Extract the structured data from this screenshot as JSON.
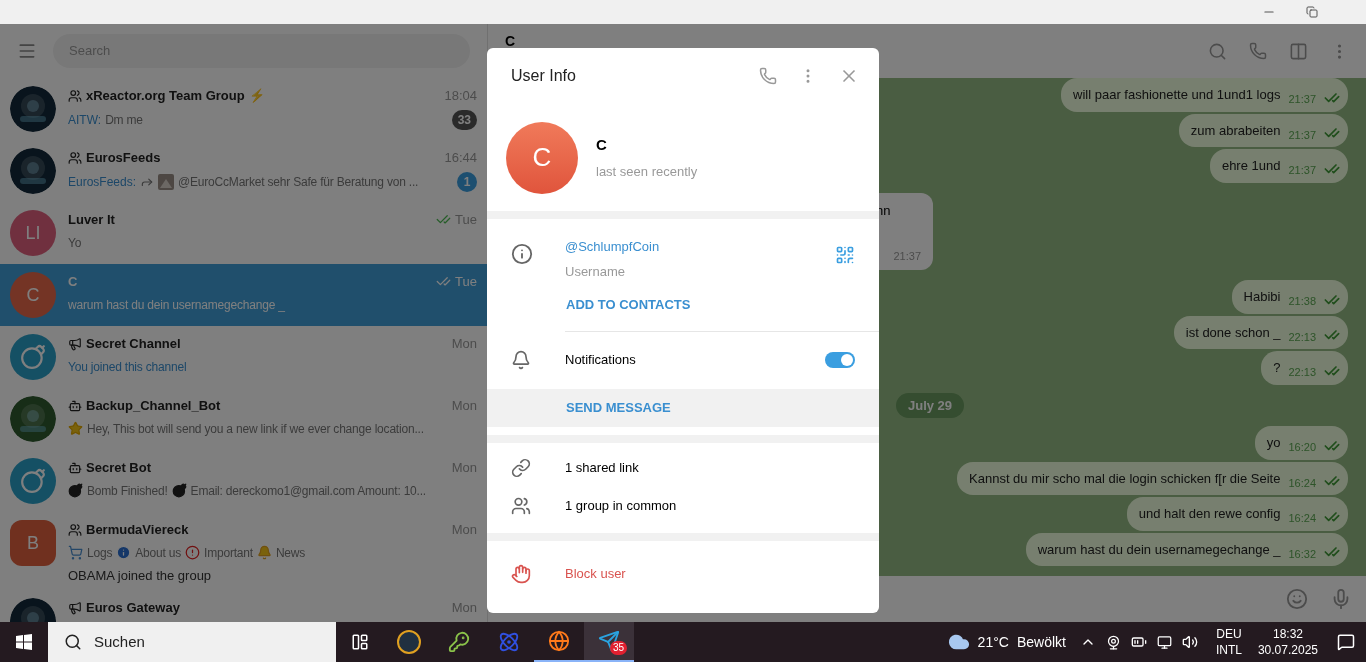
{
  "sidebar": {
    "search_placeholder": "Search",
    "chats": [
      {
        "kind": "group",
        "name": "xReactor.org Team Group",
        "name_suffix": "⚡",
        "time": "18:04",
        "avatar": {
          "kind": "picture"
        },
        "sender": "AITW:",
        "preview": [
          {
            "kind": "text",
            "text": "Dm me"
          }
        ],
        "badge": {
          "text": "33",
          "muted": true
        },
        "selected": false
      },
      {
        "kind": "group",
        "name": "EurosFeeds",
        "time": "16:44",
        "avatar": {
          "kind": "picture"
        },
        "sender": "EurosFeeds:",
        "preview": [
          {
            "kind": "forward"
          },
          {
            "kind": "thumb"
          },
          {
            "kind": "text",
            "text": "@EuroCcMarket sehr Safe für Beratung von ..."
          }
        ],
        "badge": {
          "text": "1",
          "muted": false
        },
        "selected": false
      },
      {
        "kind": "user",
        "name": "Luver It",
        "time": "Tue",
        "avatar": {
          "kind": "initials",
          "initials": "LI"
        },
        "preview": [
          {
            "kind": "text",
            "text": "Yo"
          }
        ],
        "read": true,
        "selected": false
      },
      {
        "kind": "user",
        "name": "C",
        "time": "Tue",
        "avatar": {
          "kind": "initials",
          "initials": "C"
        },
        "preview": [
          {
            "kind": "text",
            "text": "warum hast du dein usernamegechange _"
          }
        ],
        "read": true,
        "selected": true
      },
      {
        "kind": "channel",
        "name": "Secret Channel",
        "time": "Mon",
        "avatar": {
          "kind": "bomb"
        },
        "service": true,
        "preview": [
          {
            "kind": "text",
            "text": "You joined this channel"
          }
        ],
        "selected": false
      },
      {
        "kind": "bot",
        "name": "Backup_Channel_Bot",
        "time": "Mon",
        "avatar": {
          "kind": "picture"
        },
        "preview": [
          {
            "kind": "star"
          },
          {
            "kind": "text",
            "text": "Hey, This bot will send you a new link if we ever change location..."
          }
        ],
        "selected": false
      },
      {
        "kind": "bot",
        "name": "Secret Bot",
        "time": "Mon",
        "avatar": {
          "kind": "bomb"
        },
        "preview": [
          {
            "kind": "bomb"
          },
          {
            "kind": "text",
            "text": "Bomb Finished!"
          },
          {
            "kind": "bomb"
          },
          {
            "kind": "text",
            "text": "Email: dereckomo1@gmail.com Amount: 10..."
          }
        ],
        "selected": false
      },
      {
        "kind": "group",
        "name": "BermudaViereck",
        "time": "Mon",
        "avatar": {
          "kind": "initials_square",
          "initials": "B"
        },
        "preview": [
          {
            "kind": "cart"
          },
          {
            "kind": "text",
            "text": "Logs"
          },
          {
            "kind": "info"
          },
          {
            "kind": "text",
            "text": "About us"
          },
          {
            "kind": "exclaim"
          },
          {
            "kind": "text",
            "text": "Important"
          },
          {
            "kind": "bell"
          },
          {
            "kind": "text",
            "text": "News"
          }
        ],
        "last_line": "OBAMA joined the group",
        "selected": false
      },
      {
        "kind": "channel",
        "name": "Euros Gateway",
        "time": "Mon",
        "avatar": {
          "kind": "picture"
        },
        "selected": false
      }
    ]
  },
  "chat": {
    "title": "C",
    "messages": [
      {
        "kind": "message",
        "text": "will paar fashionette und 1und1 logs",
        "time": "21:37",
        "outgoing": true,
        "read": true
      },
      {
        "kind": "message",
        "text": "zum abrabeiten",
        "time": "21:37",
        "outgoing": true,
        "read": true
      },
      {
        "kind": "message",
        "text": "ehre 1und",
        "time": "21:37",
        "outgoing": true,
        "read": true
      },
      {
        "kind": "message",
        "text": "nn",
        "time": "21:37",
        "outgoing": false
      },
      {
        "kind": "message",
        "text": "Habibi",
        "time": "21:38",
        "outgoing": true,
        "read": true
      },
      {
        "kind": "message",
        "text": "ist done schon _",
        "time": "22:13",
        "outgoing": true,
        "read": true
      },
      {
        "kind": "message",
        "text": "?",
        "time": "22:13",
        "outgoing": true,
        "read": true
      },
      {
        "kind": "date",
        "text": "July 29"
      },
      {
        "kind": "message",
        "text": "yo",
        "time": "16:20",
        "outgoing": true,
        "read": true
      },
      {
        "kind": "message",
        "text": "Kannst du mir scho mal die login schicken f[r die Seite",
        "time": "16:24",
        "outgoing": true,
        "read": true
      },
      {
        "kind": "message",
        "text": "und halt den rewe config",
        "time": "16:24",
        "outgoing": true,
        "read": true
      },
      {
        "kind": "message",
        "text": "warum hast du dein usernamegechange _",
        "time": "16:32",
        "outgoing": true,
        "read": true
      }
    ]
  },
  "user_info": {
    "title": "User Info",
    "initials": "C",
    "name": "C",
    "status": "last seen recently",
    "username": "@SchlumpfCoin",
    "username_label": "Username",
    "add_contact": "ADD TO CONTACTS",
    "notifications_label": "Notifications",
    "notifications_on": true,
    "send_message": "SEND MESSAGE",
    "shared_links": "1 shared link",
    "groups_in_common": "1 group in common",
    "block": "Block user"
  },
  "taskbar": {
    "search_placeholder": "Suchen",
    "telegram_badge": "35",
    "temperature": "21°C",
    "weather": "Bewölkt",
    "lang_1": "DEU",
    "lang_2": "INTL",
    "time": "18:32",
    "date": "30.07.2025"
  }
}
